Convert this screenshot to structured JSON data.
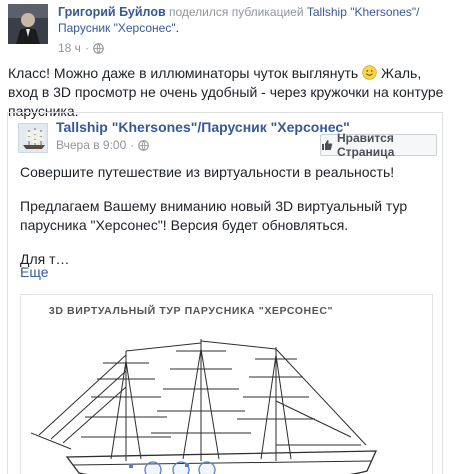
{
  "post": {
    "author": "Григорий Буйлов",
    "shared_verb": "поделился публикацией",
    "shared_page": "Tallship \"Khersones\"/Парусник \"Херсонес\"",
    "timestamp": "18 ч",
    "body_text": "Класс! Можно даже в иллюминаторы чуток выглянуть",
    "body_text_cont": "Жаль, вход в 3D просмотр не очень удобный - через кружочки на контуре парусника."
  },
  "shared": {
    "page_name": "Tallship \"Khersones\"/Парусник \"Херсонес\"",
    "time": "Вчера в 9:00",
    "like_button": "Нравится Страница",
    "paragraph1": "Совершите путешествие из виртуальности в реальность!",
    "paragraph2": "Предлагаем Вашему вниманию новый 3D виртуальный тур парусника \"Херсонес\"! Версия будет обновляться.",
    "paragraph3": "Для т…",
    "see_more": "Еще",
    "banner_title": "3D ВИРТУАЛЬНЫЙ ТУР ПАРУСНИКА \"ХЕРСОНЕС\""
  },
  "icons": [
    "globe-icon",
    "smile-icon",
    "thumbs-up-icon",
    "avatar",
    "ship-icon"
  ],
  "colors": {
    "link": "#365899",
    "meta": "#90949c",
    "text": "#1d2129",
    "border": "#dddfe2"
  }
}
